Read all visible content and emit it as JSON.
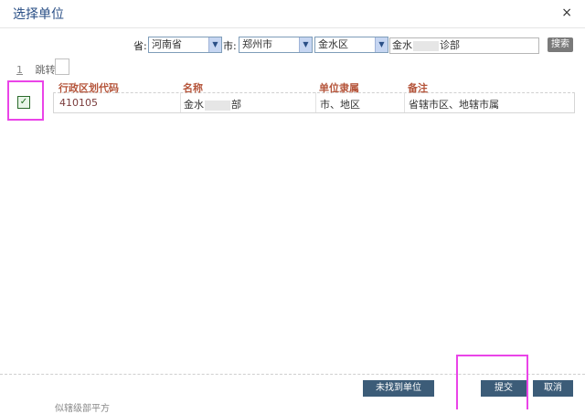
{
  "dialog": {
    "title": "选择单位",
    "close_glyph": "×"
  },
  "filters": {
    "province_label": "省:",
    "province_value": "河南省",
    "city_label": "市:",
    "city_value": "郑州市",
    "district_value": "金水区",
    "search_value_prefix": "金水",
    "search_value_suffix": "诊部",
    "search_button": "搜索"
  },
  "pager": {
    "page": "1",
    "jump_label": "跳转:"
  },
  "table": {
    "headers": [
      "行政区划代码",
      "名称",
      "单位隶属",
      "备注"
    ],
    "rows": [
      {
        "code": "410105",
        "name_prefix": "金水",
        "name_suffix": "部",
        "affiliation": "市、地区",
        "remark": "省辖市区、地辖市属"
      }
    ]
  },
  "footer": {
    "not_found_button": "未找到单位",
    "submit_button": "提交",
    "cancel_button": "取消",
    "bottom_text": "似辖级部平方"
  }
}
